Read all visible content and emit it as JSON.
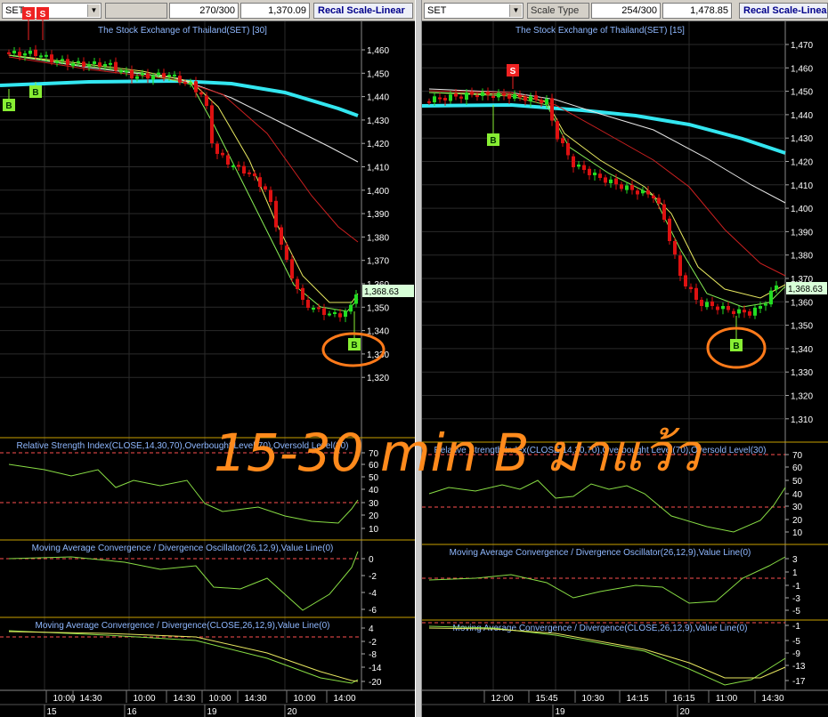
{
  "panes": [
    {
      "symbol": "SET",
      "scale_type_label": "",
      "count": "270/300",
      "last_value": "1,370.09",
      "recal_button": "Recal Scale-Linear",
      "title": "The Stock Exchange of Thailand(SET) [30]",
      "price_ticks": [
        "1,460",
        "1,450",
        "1,440",
        "1,430",
        "1,420",
        "1,410",
        "1,400",
        "1,390",
        "1,380",
        "1,370",
        "1,360",
        "1,350",
        "1,340",
        "1,330",
        "1,320"
      ],
      "current_price_label": "1,368.63",
      "rsi_title": "Relative Strength Index(CLOSE,14,30,70),Overbought Level(70),Oversold Level(30)",
      "rsi_ticks": [
        "70",
        "60",
        "50",
        "40",
        "30",
        "20",
        "10"
      ],
      "macd_osc_title": "Moving Average Convergence / Divergence Oscillator(26,12,9),Value Line(0)",
      "macd_osc_ticks": [
        "0",
        "-2",
        "-4",
        "-6"
      ],
      "macd_title": "Moving Average Convergence / Divergence(CLOSE,26,12,9),Value Line(0)",
      "macd_ticks": [
        "4",
        "-2",
        "-8",
        "-14",
        "-20"
      ],
      "time_labels": [
        "10:00",
        "14:30",
        "10:00",
        "14:30",
        "10:00",
        "14:30",
        "10:00",
        "14:00"
      ],
      "day_labels": [
        "15",
        "16",
        "19",
        "20"
      ],
      "signals": [
        "S",
        "S",
        "B",
        "B",
        "B"
      ]
    },
    {
      "symbol": "SET",
      "scale_type_label": "Scale Type",
      "count": "254/300",
      "last_value": "1,478.85",
      "recal_button": "Recal Scale-Linear",
      "title": "The Stock Exchange of Thailand(SET) [15]",
      "price_ticks": [
        "1,470",
        "1,460",
        "1,450",
        "1,440",
        "1,430",
        "1,420",
        "1,410",
        "1,400",
        "1,390",
        "1,380",
        "1,370",
        "1,360",
        "1,350",
        "1,340",
        "1,330",
        "1,320",
        "1,310"
      ],
      "current_price_label": "1,368.63",
      "rsi_title": "Relative Strength Index(CLOSE,14,30,70),Overbought Level(70),Oversold Level(30)",
      "rsi_ticks": [
        "70",
        "60",
        "50",
        "40",
        "30",
        "20",
        "10"
      ],
      "macd_osc_title": "Moving Average Convergence / Divergence Oscillator(26,12,9),Value Line(0)",
      "macd_osc_ticks": [
        "3",
        "1",
        "-1",
        "-3",
        "-5"
      ],
      "macd_title": "Moving Average Convergence / Divergence(CLOSE,26,12,9),Value Line(0)",
      "macd_ticks": [
        "-1",
        "-5",
        "-9",
        "-13",
        "-17"
      ],
      "time_labels": [
        "12:00",
        "15:45",
        "10:30",
        "14:15",
        "16:15",
        "11:00",
        "14:30"
      ],
      "day_labels": [
        "19",
        "20"
      ],
      "signals": [
        "S",
        "B",
        "B"
      ]
    }
  ],
  "overlay_text": "15-30 min  B มาแว้ว",
  "colors": {
    "background": "#000000",
    "grid": "#2a2a2a",
    "axis_text": "#ffffff",
    "title_text": "#8fb8ff",
    "up_candle": "#22dd22",
    "down_candle": "#dd1111",
    "long_ma": "#33e6f0",
    "ma_red": "#cc2020",
    "ma_white": "#e8e8e8",
    "ma_yellow": "#e8e860",
    "ma_green": "#88ee55",
    "indicator_line": "#88dd44",
    "ref_line": "#ff5050",
    "highlight_circle": "#ff7a1a",
    "overlay_text": "#ff8a1c",
    "buy_signal": "#88ee33",
    "sell_signal": "#ee2222"
  }
}
